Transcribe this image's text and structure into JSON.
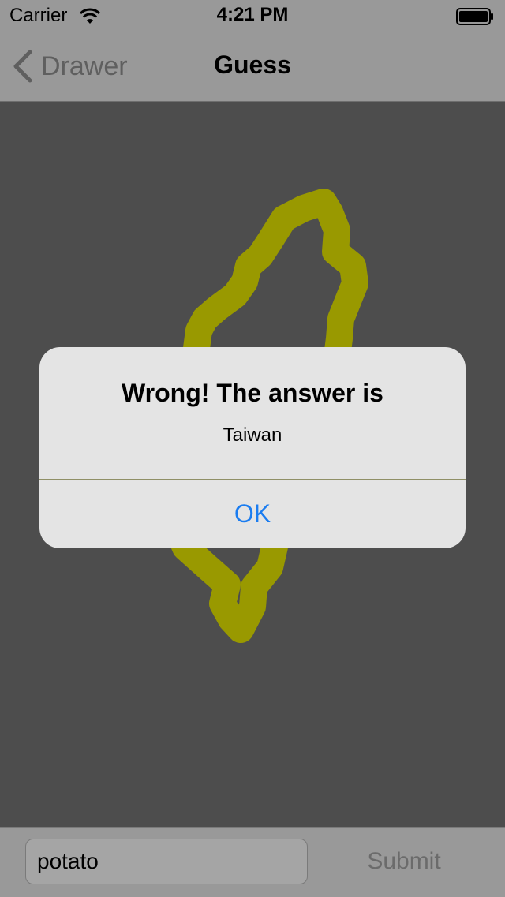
{
  "status_bar": {
    "carrier": "Carrier",
    "time": "4:21 PM"
  },
  "nav": {
    "back_label": "Drawer",
    "title": "Guess"
  },
  "drawing": {
    "stroke_color": "#999900",
    "background_color": "#4d4d4d"
  },
  "alert": {
    "title": "Wrong! The answer is",
    "message": "Taiwan",
    "ok_label": "OK",
    "ok_color": "#1a7cf0"
  },
  "bottom": {
    "input_value": "potato",
    "submit_label": "Submit"
  },
  "icons": {
    "wifi": "wifi-icon",
    "battery": "battery-icon",
    "back": "chevron-left-icon"
  }
}
